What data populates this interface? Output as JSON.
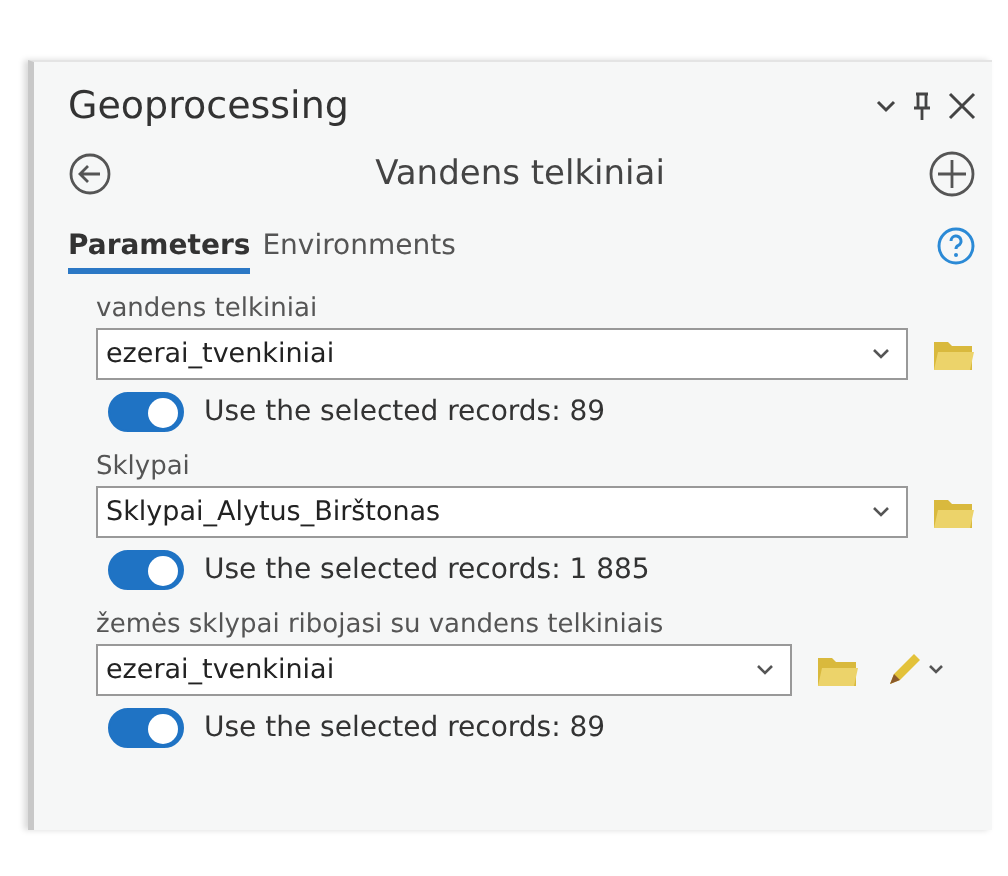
{
  "window": {
    "title": "Geoprocessing"
  },
  "tool": {
    "title": "Vandens telkiniai"
  },
  "tabs": [
    {
      "label": "Parameters",
      "selected": true
    },
    {
      "label": "Environments",
      "selected": false
    }
  ],
  "parameters": [
    {
      "kind": "plain",
      "label": "vandens telkiniai",
      "value": "ezerai_tvenkiniai",
      "toggle": {
        "on": true,
        "label": "Use the selected records: 89"
      }
    },
    {
      "kind": "plain",
      "label": "Sklypai",
      "value": "Sklypai_Alytus_Birštonas",
      "toggle": {
        "on": true,
        "label": "Use the selected records: 1 885"
      }
    },
    {
      "kind": "editable",
      "label": "žemės sklypai ribojasi su vandens telkiniais",
      "value": "ezerai_tvenkiniai",
      "toggle": {
        "on": true,
        "label": "Use the selected records: 89"
      }
    }
  ]
}
